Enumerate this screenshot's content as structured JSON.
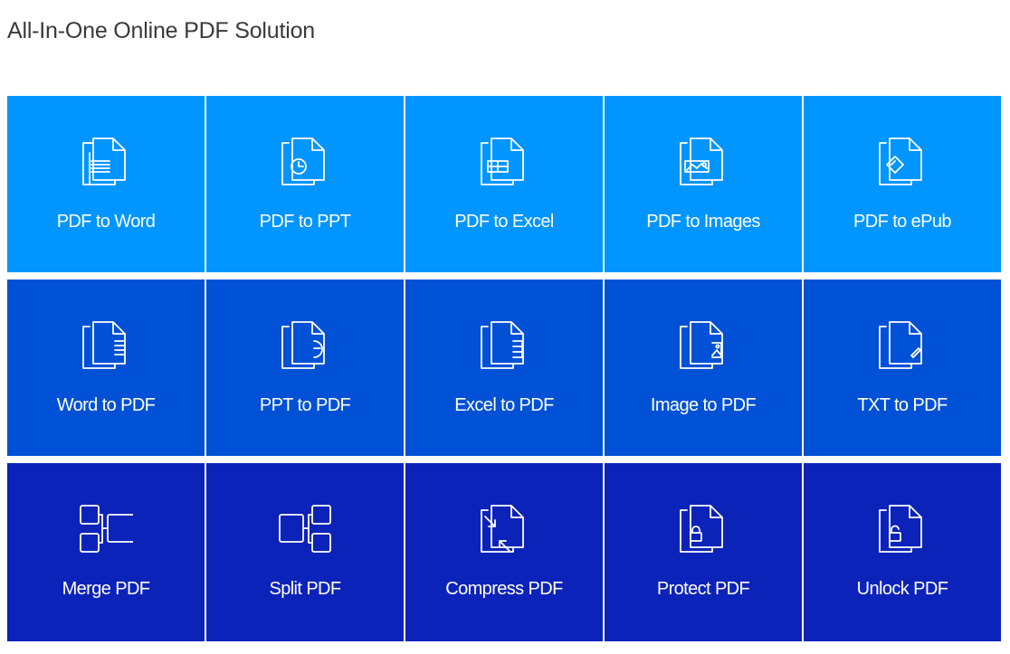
{
  "page": {
    "title": "All-In-One Online PDF Solution"
  },
  "colors": {
    "row1": "#0095ff",
    "row2": "#0051d5",
    "row3": "#0c23ba",
    "icon_stroke": "#ffffff"
  },
  "rows": [
    {
      "tiles": [
        {
          "label": "PDF to Word",
          "icon": "pdf-to-word-icon"
        },
        {
          "label": "PDF to PPT",
          "icon": "pdf-to-ppt-icon"
        },
        {
          "label": "PDF to Excel",
          "icon": "pdf-to-excel-icon"
        },
        {
          "label": "PDF to Images",
          "icon": "pdf-to-images-icon"
        },
        {
          "label": "PDF to ePub",
          "icon": "pdf-to-epub-icon"
        }
      ]
    },
    {
      "tiles": [
        {
          "label": "Word to PDF",
          "icon": "word-to-pdf-icon"
        },
        {
          "label": "PPT to PDF",
          "icon": "ppt-to-pdf-icon"
        },
        {
          "label": "Excel to PDF",
          "icon": "excel-to-pdf-icon"
        },
        {
          "label": "Image to PDF",
          "icon": "image-to-pdf-icon"
        },
        {
          "label": "TXT to PDF",
          "icon": "txt-to-pdf-icon"
        }
      ]
    },
    {
      "tiles": [
        {
          "label": "Merge PDF",
          "icon": "merge-pdf-icon"
        },
        {
          "label": "Split PDF",
          "icon": "split-pdf-icon"
        },
        {
          "label": "Compress PDF",
          "icon": "compress-pdf-icon"
        },
        {
          "label": "Protect PDF",
          "icon": "lock-icon"
        },
        {
          "label": "Unlock PDF",
          "icon": "unlock-icon"
        }
      ]
    }
  ]
}
